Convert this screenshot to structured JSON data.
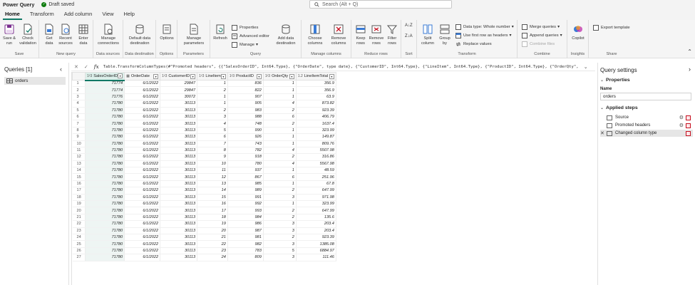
{
  "app": {
    "title": "Power Query",
    "status": "Draft saved"
  },
  "search": {
    "placeholder": "Search (Alt + Q)"
  },
  "menu": {
    "tabs": [
      "Home",
      "Transform",
      "Add column",
      "View",
      "Help"
    ],
    "active": "Home"
  },
  "ribbon": {
    "groups": {
      "save": "Save",
      "new_query": "New query",
      "data_sources": "Data sources",
      "data_destination": "Data destination",
      "options": "Options",
      "parameters": "Parameters",
      "query": "Query",
      "manage_columns": "Manage columns",
      "reduce_rows": "Reduce rows",
      "sort": "Sort",
      "transform": "Transform",
      "combine": "Combine",
      "insights": "Insights",
      "share": "Share"
    },
    "buttons": {
      "save_run": "Save & run",
      "check_validation": "Check validation",
      "get_data": "Get data",
      "recent_sources": "Recent sources",
      "enter_data": "Enter data",
      "manage_connections": "Manage connections",
      "default_destination": "Default data destination",
      "options": "Options",
      "manage_parameters": "Manage parameters",
      "refresh": "Refresh",
      "properties": "Properties",
      "advanced_editor": "Advanced editor",
      "manage": "Manage",
      "add_destination": "Add data destination",
      "choose_columns": "Choose columns",
      "remove_columns": "Remove columns",
      "keep_rows": "Keep rows",
      "remove_rows": "Remove rows",
      "filter_rows": "Filter rows",
      "split_column": "Split column",
      "group_by": "Group by",
      "data_type": "Data type: Whole number",
      "first_row_headers": "Use first row as headers",
      "replace_values": "Replace values",
      "merge_queries": "Merge queries",
      "append_queries": "Append queries",
      "combine_files": "Combine files",
      "copilot": "Copilot",
      "export_template": "Export template"
    }
  },
  "queries_pane": {
    "title": "Queries [1]",
    "items": [
      "orders"
    ]
  },
  "formula": {
    "text": "Table.TransformColumnTypes(#\"Promoted headers\", {{\"SalesOrderID\", Int64.Type}, {\"OrderDate\", type date}, {\"CustomerID\", Int64.Type}, {\"LineItem\", Int64.Type}, {\"ProductID\", Int64.Type}, {\"OrderQty\","
  },
  "grid": {
    "columns": [
      {
        "name": "SalesOrderID",
        "type": "1²3"
      },
      {
        "name": "OrderDate",
        "type": "▦"
      },
      {
        "name": "CustomerID",
        "type": "1²3"
      },
      {
        "name": "LineItem",
        "type": "1²3"
      },
      {
        "name": "ProductID",
        "type": "1²3"
      },
      {
        "name": "OrderQty",
        "type": "1²3"
      },
      {
        "name": "LineItemTotal",
        "type": "1.2"
      }
    ],
    "rows": [
      [
        "1",
        "71774",
        "6/1/2022",
        "29847",
        "1",
        "836",
        "1",
        "356.9"
      ],
      [
        "2",
        "71774",
        "6/1/2022",
        "29847",
        "2",
        "822",
        "1",
        "356.9"
      ],
      [
        "3",
        "71776",
        "6/1/2022",
        "30072",
        "1",
        "907",
        "1",
        "63.9"
      ],
      [
        "4",
        "71780",
        "6/1/2022",
        "30113",
        "1",
        "905",
        "4",
        "873.82"
      ],
      [
        "5",
        "71780",
        "6/1/2022",
        "30113",
        "2",
        "983",
        "2",
        "923.39"
      ],
      [
        "6",
        "71780",
        "6/1/2022",
        "30113",
        "3",
        "988",
        "6",
        "406.79"
      ],
      [
        "7",
        "71780",
        "6/1/2022",
        "30113",
        "4",
        "748",
        "2",
        "1637.4"
      ],
      [
        "8",
        "71780",
        "6/1/2022",
        "30113",
        "5",
        "990",
        "1",
        "323.99"
      ],
      [
        "9",
        "71780",
        "6/1/2022",
        "30113",
        "6",
        "926",
        "1",
        "149.87"
      ],
      [
        "10",
        "71780",
        "6/1/2022",
        "30113",
        "7",
        "743",
        "1",
        "809.76"
      ],
      [
        "11",
        "71780",
        "6/1/2022",
        "30113",
        "8",
        "782",
        "4",
        "5507.98"
      ],
      [
        "12",
        "71780",
        "6/1/2022",
        "30113",
        "9",
        "918",
        "2",
        "316.86"
      ],
      [
        "13",
        "71780",
        "6/1/2022",
        "30113",
        "10",
        "780",
        "4",
        "5567.98"
      ],
      [
        "14",
        "71780",
        "6/1/2022",
        "30113",
        "11",
        "937",
        "1",
        "48.59"
      ],
      [
        "15",
        "71780",
        "6/1/2022",
        "30113",
        "12",
        "867",
        "6",
        "251.96"
      ],
      [
        "16",
        "71780",
        "6/1/2022",
        "30113",
        "13",
        "985",
        "1",
        "67.8"
      ],
      [
        "17",
        "71780",
        "6/1/2022",
        "30113",
        "14",
        "989",
        "2",
        "647.99"
      ],
      [
        "18",
        "71780",
        "6/1/2022",
        "30113",
        "15",
        "991",
        "3",
        "971.98"
      ],
      [
        "19",
        "71780",
        "6/1/2022",
        "30113",
        "16",
        "992",
        "1",
        "323.99"
      ],
      [
        "20",
        "71780",
        "6/1/2022",
        "30113",
        "17",
        "993",
        "2",
        "647.99"
      ],
      [
        "21",
        "71780",
        "6/1/2022",
        "30113",
        "18",
        "984",
        "2",
        "135.6"
      ],
      [
        "22",
        "71780",
        "6/1/2022",
        "30113",
        "19",
        "986",
        "3",
        "203.4"
      ],
      [
        "23",
        "71780",
        "6/1/2022",
        "30113",
        "20",
        "987",
        "3",
        "203.4"
      ],
      [
        "24",
        "71780",
        "6/1/2022",
        "30113",
        "21",
        "981",
        "2",
        "923.39"
      ],
      [
        "25",
        "71780",
        "6/1/2022",
        "30113",
        "22",
        "982",
        "3",
        "1385.08"
      ],
      [
        "26",
        "71780",
        "6/1/2022",
        "30113",
        "23",
        "783",
        "5",
        "6884.97"
      ],
      [
        "27",
        "71780",
        "6/1/2022",
        "30113",
        "24",
        "809",
        "3",
        "111.46"
      ]
    ]
  },
  "settings": {
    "title": "Query settings",
    "properties_label": "Properties",
    "name_label": "Name",
    "name_value": "orders",
    "applied_steps_label": "Applied steps",
    "steps": [
      "Source",
      "Promoted headers",
      "Changed column type"
    ]
  },
  "colors": {
    "accent": "#117865",
    "ribbon_bg": "#f5f5f5",
    "selected_col": "#dcefea"
  }
}
